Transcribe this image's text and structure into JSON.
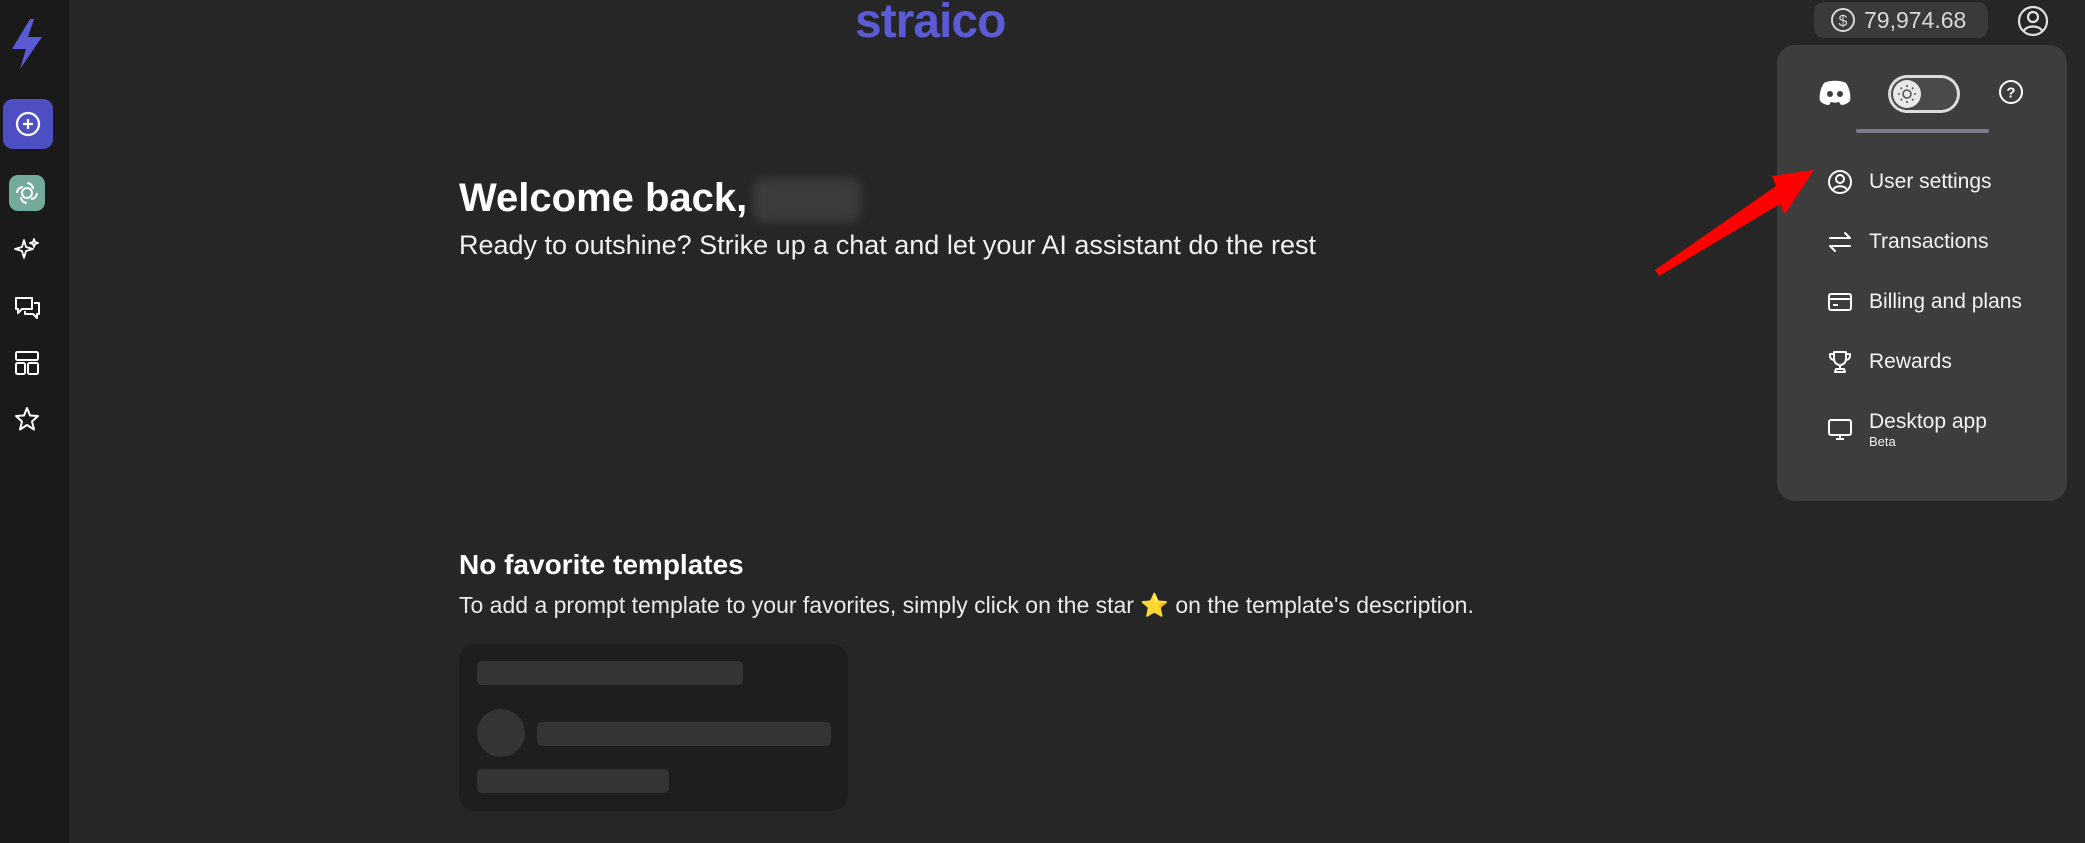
{
  "app": {
    "logo_text": "straico"
  },
  "header": {
    "balance": "79,974.68"
  },
  "main": {
    "welcome": "Welcome back,",
    "tagline": "Ready to outshine? Strike up a chat and let your AI assistant do the rest",
    "favorites_title": "No favorite templates",
    "favorites_desc_before": "To add a prompt template to your favorites, simply click on the star",
    "favorites_star": "⭐",
    "favorites_desc_after": "on the template's description."
  },
  "menu": {
    "items": [
      {
        "label": "User settings",
        "icon": "user-circle-icon"
      },
      {
        "label": "Transactions",
        "icon": "transfer-icon"
      },
      {
        "label": "Billing and plans",
        "icon": "credit-card-icon"
      },
      {
        "label": "Rewards",
        "icon": "trophy-icon"
      },
      {
        "label": "Desktop app",
        "sub": "Beta",
        "icon": "monitor-icon"
      }
    ]
  },
  "sidebar": {
    "icons": [
      "lightning-logo-icon",
      "plus-circle-icon",
      "openai-icon",
      "sparkles-icon",
      "chat-bubbles-icon",
      "template-layout-icon",
      "star-icon"
    ]
  },
  "colors": {
    "accent": "#5b5bd6",
    "annotation_arrow": "#ff0000"
  }
}
